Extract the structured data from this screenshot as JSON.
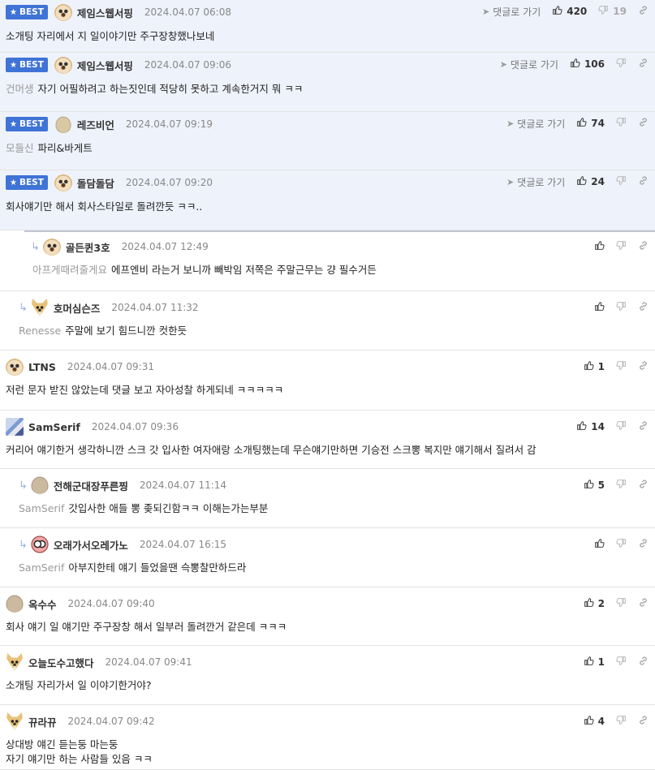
{
  "labels": {
    "best": "BEST",
    "goto": "댓글로 가기"
  },
  "comments": [
    {
      "best": true,
      "avatar": "dog-avatar",
      "nick": "제임스웹서핑",
      "date": "2024.04.07 06:08",
      "ref": "",
      "text": "소개팅 자리에서 지 일이야기만 주구장창했나보네",
      "goto": true,
      "up": "420",
      "down": "19"
    },
    {
      "best": true,
      "avatar": "dog-avatar",
      "nick": "제임스웹서핑",
      "date": "2024.04.07 09:06",
      "ref": "건머생",
      "text": "자기 어필하려고 하는짓인데 적당히 못하고 계속한거지 뭐 ㅋㅋ",
      "goto": true,
      "up": "106",
      "down": ""
    },
    {
      "best": true,
      "avatar": "blob-avatar",
      "nick": "레즈비언",
      "date": "2024.04.07 09:19",
      "ref": "모들신",
      "text": "파리&바게트",
      "goto": true,
      "up": "74",
      "down": ""
    },
    {
      "best": true,
      "avatar": "dog-avatar",
      "nick": "돌담돌담",
      "date": "2024.04.07 09:20",
      "ref": "",
      "text": "회사얘기만 해서 회사스타일로 돌려깐듯 ㅋㅋ..",
      "goto": true,
      "up": "24",
      "down": ""
    },
    {
      "best": false,
      "reply": true,
      "avatar": "dog-avatar",
      "nick": "골든퀸3호",
      "date": "2024.04.07 12:49",
      "ref": "아프게때려줄게요",
      "text": "에프엔비 라는거 보니까 빼박임 저쪽은 주말근무는 걍 필수거든",
      "goto": false,
      "up": "",
      "down": ""
    },
    {
      "best": false,
      "reply": true,
      "avatar": "fox-avatar",
      "nick": "호머심슨즈",
      "date": "2024.04.07 11:32",
      "ref": "Renesse",
      "text": "주말에 보기 힘드니깐 컷한듯",
      "goto": false,
      "up": "",
      "down": ""
    },
    {
      "best": false,
      "reply": false,
      "avatar": "dog-avatar",
      "nick": "LTNS",
      "date": "2024.04.07 09:31",
      "ref": "",
      "text": "저런 문자 받진 않았는데 댓글 보고 자아성찰 하게되네 ㅋㅋㅋㅋㅋ",
      "goto": false,
      "up": "1",
      "down": ""
    },
    {
      "best": false,
      "reply": false,
      "avatar": "samserif-avatar",
      "nick": "SamSerif",
      "date": "2024.04.07 09:36",
      "ref": "",
      "text": "커리어 얘기한거 생각하니깐 스크 갓 입사한 여자애랑 소개팅했는데 무슨얘기만하면 기승전 스크뽕 복지만 얘기해서 질려서 감",
      "goto": false,
      "up": "14",
      "down": ""
    },
    {
      "best": false,
      "reply": true,
      "avatar": "ball-avatar",
      "nick": "전해군대장푸른찡",
      "date": "2024.04.07 11:14",
      "ref": "SamSerif",
      "text": "갓입사한 애들 뽕 좆되긴함ㅋㅋ 이해는가는부분",
      "goto": false,
      "up": "5",
      "down": ""
    },
    {
      "best": false,
      "reply": true,
      "avatar": "owl-avatar",
      "nick": "오래가서오레가노",
      "date": "2024.04.07 16:15",
      "ref": "SamSerif",
      "text": "아부지한테 얘기 들었을땐 슥뽕찰만하드라",
      "goto": false,
      "up": "",
      "down": ""
    },
    {
      "best": false,
      "reply": false,
      "avatar": "ball-avatar",
      "nick": "옥수수",
      "date": "2024.04.07 09:40",
      "ref": "",
      "text": "회사 얘기 일 얘기만 주구장창 해서 일부러 돌려깐거 같은데 ㅋㅋㅋ",
      "goto": false,
      "up": "2",
      "down": ""
    },
    {
      "best": false,
      "reply": false,
      "avatar": "fox-avatar",
      "nick": "오늘도수고했다",
      "date": "2024.04.07 09:41",
      "ref": "",
      "text": "소개팅 자리가서 일 이야기한거야?",
      "goto": false,
      "up": "1",
      "down": ""
    },
    {
      "best": false,
      "reply": false,
      "avatar": "fox-avatar",
      "nick": "뀨라뀨",
      "date": "2024.04.07 09:42",
      "ref": "",
      "text": "상대방 얘긴 듣는둥 마는둥",
      "text2": "자기 얘기만 하는 사람들 있음 ㅋㅋ",
      "goto": false,
      "up": "4",
      "down": ""
    }
  ]
}
